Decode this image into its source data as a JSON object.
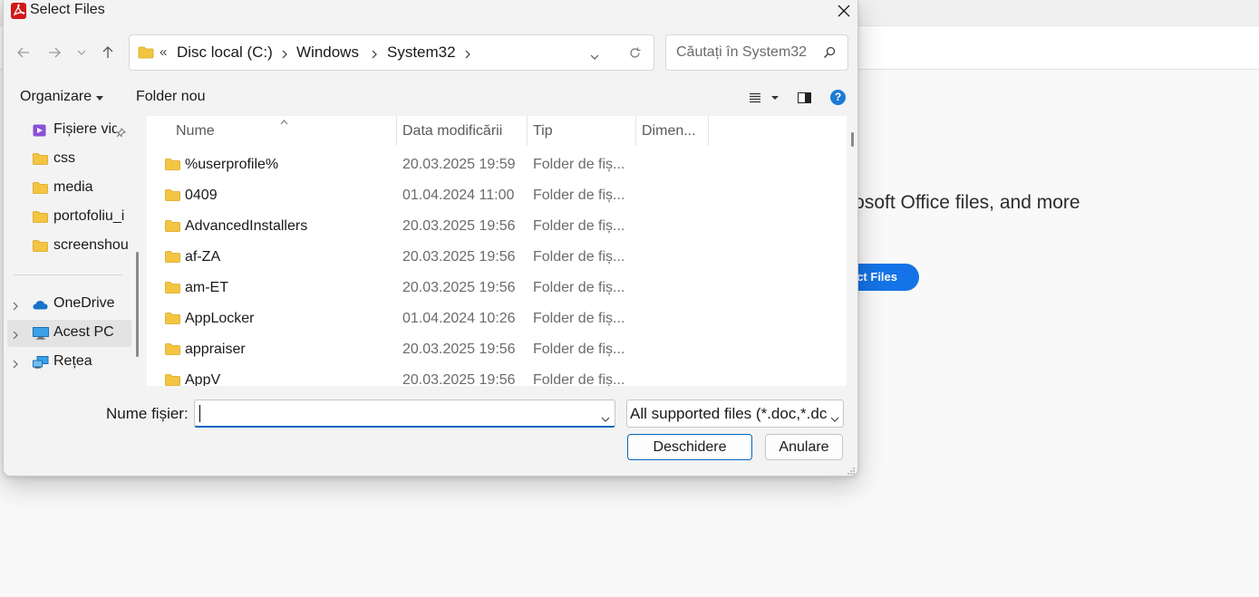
{
  "background_app": {
    "headline": "icrosoft Office files, and more",
    "select_button": "ct Files",
    "accent": "#1473e6"
  },
  "dialog": {
    "title": "Select Files",
    "app_icon": "acrobat-pdf-icon",
    "close_icon": "close-icon"
  },
  "navigation": {
    "back_icon": "back-arrow-icon",
    "forward_icon": "forward-arrow-icon",
    "recent_icon": "chevron-down-icon",
    "up_icon": "up-arrow-icon"
  },
  "address_bar": {
    "overflow": "«",
    "breadcrumbs": [
      "Disc local (C:)",
      "Windows",
      "System32"
    ]
  },
  "search": {
    "placeholder": "Căutați în System32"
  },
  "toolbar": {
    "organize_label": "Organizare",
    "new_folder_label": "Folder nou",
    "help_label": "?"
  },
  "nav_pane": {
    "items": [
      {
        "label": "Fișiere vid",
        "icon": "video-folder-icon",
        "pinned": true
      },
      {
        "label": "css",
        "icon": "folder-icon"
      },
      {
        "label": "media",
        "icon": "folder-icon"
      },
      {
        "label": "portofoliu_i",
        "icon": "folder-icon"
      },
      {
        "label": "screenshou",
        "icon": "folder-icon"
      },
      {
        "label": "OneDrive",
        "icon": "cloud-icon"
      },
      {
        "label": "Acest PC",
        "icon": "computer-icon",
        "selected": true
      },
      {
        "label": "Rețea",
        "icon": "network-icon"
      }
    ]
  },
  "file_list": {
    "columns": [
      "Nume",
      "Data modificării",
      "Tip",
      "Dimen..."
    ],
    "rows": [
      {
        "name": "%userprofile%",
        "date": "20.03.2025 19:59",
        "type": "Folder de fiș..."
      },
      {
        "name": "0409",
        "date": "01.04.2024 11:00",
        "type": "Folder de fiș..."
      },
      {
        "name": "AdvancedInstallers",
        "date": "20.03.2025 19:56",
        "type": "Folder de fiș..."
      },
      {
        "name": "af-ZA",
        "date": "20.03.2025 19:56",
        "type": "Folder de fiș..."
      },
      {
        "name": "am-ET",
        "date": "20.03.2025 19:56",
        "type": "Folder de fiș..."
      },
      {
        "name": "AppLocker",
        "date": "01.04.2024 10:26",
        "type": "Folder de fiș..."
      },
      {
        "name": "appraiser",
        "date": "20.03.2025 19:56",
        "type": "Folder de fiș..."
      },
      {
        "name": "AppV",
        "date": "20.03.2025 19:56",
        "type": "Folder de fiș..."
      }
    ]
  },
  "bottom": {
    "filename_label": "Nume fișier:",
    "filename_value": "",
    "filetype_value": "All supported files (*.doc,*.dc",
    "open_label": "Deschidere",
    "cancel_label": "Anulare"
  },
  "colors": {
    "focus_blue": "#0067c0",
    "folder_yellow": "#f4c542",
    "help_blue": "#1c7ad6"
  }
}
